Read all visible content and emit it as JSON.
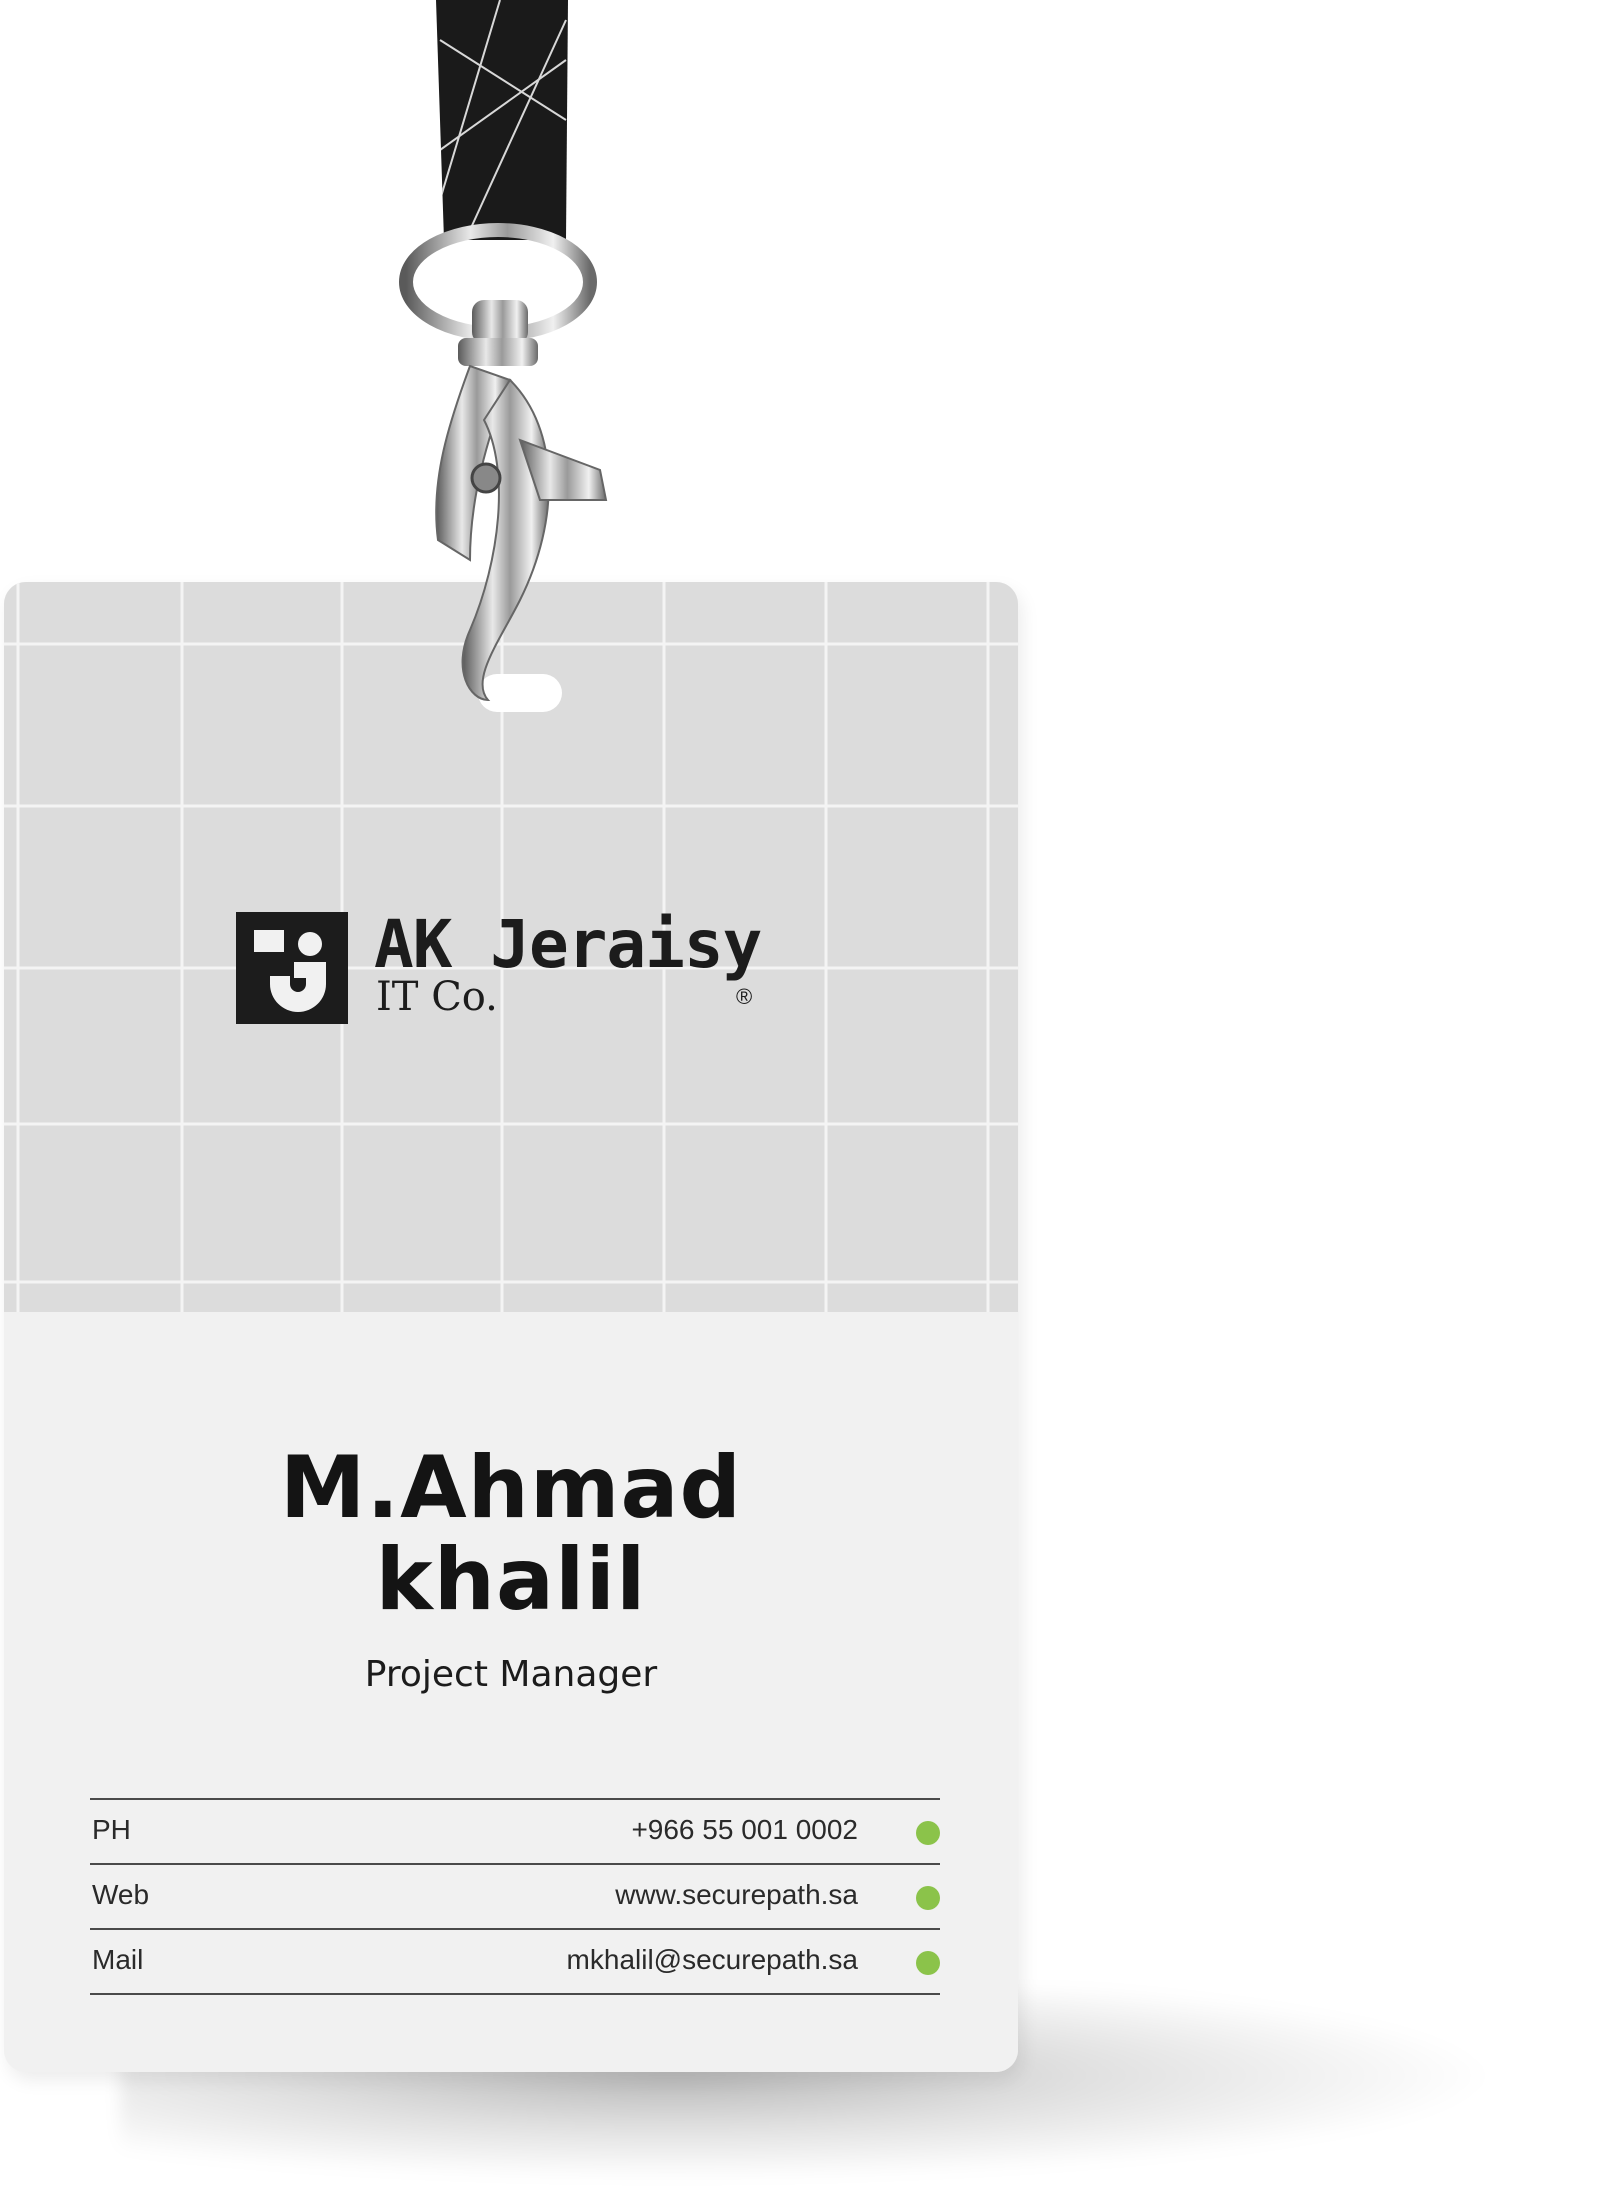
{
  "company": {
    "name": "AK Jeraisy",
    "subline": "IT Co.",
    "registered_mark": "®"
  },
  "person": {
    "name_line1": "M.Ahmad",
    "name_line2": "khalil",
    "title": "Project Manager"
  },
  "contacts": [
    {
      "label": "PH",
      "value": "+966 55 001 0002"
    },
    {
      "label": "Web",
      "value": "www.securepath.sa"
    },
    {
      "label": "Mail",
      "value": "mkhalil@securepath.sa"
    }
  ],
  "colors": {
    "accent_dot": "#8bc34a",
    "badge_top": "#dcdcdc",
    "badge_bottom": "#f1f1f1",
    "text": "#1c1c1c",
    "lanyard": "#1a1a1a"
  },
  "icons": [
    "lanyard-strap",
    "metal-clasp",
    "company-logo-mark",
    "status-dot"
  ]
}
